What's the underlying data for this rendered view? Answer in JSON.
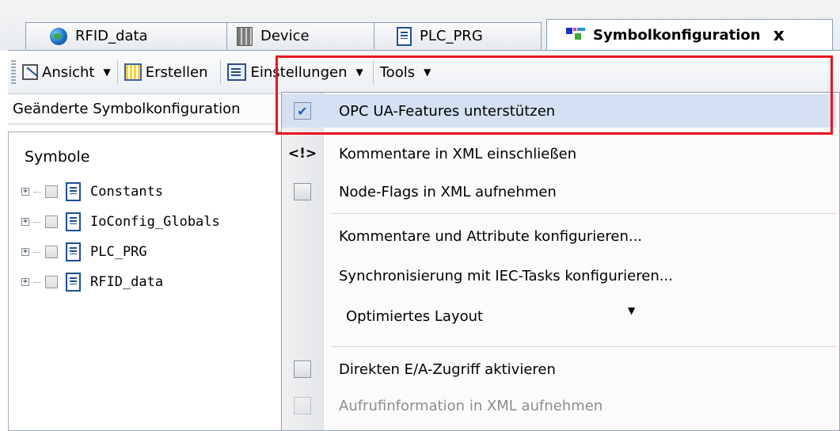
{
  "tabs": [
    {
      "label": "RFID_data",
      "icon": "globe-icon"
    },
    {
      "label": "Device",
      "icon": "device-icon"
    },
    {
      "label": "PLC_PRG",
      "icon": "document-icon"
    },
    {
      "label": "Symbolkonfiguration",
      "icon": "symbol-config-icon",
      "active": true,
      "close": "x"
    }
  ],
  "toolbar": {
    "view_label": "Ansicht",
    "create_label": "Erstellen",
    "settings_label": "Einstellungen",
    "tools_label": "Tools"
  },
  "status_text": "Geänderte Symbolkonfiguration",
  "tree": {
    "title": "Symbole",
    "items": [
      {
        "label": "Constants"
      },
      {
        "label": "IoConfig_Globals"
      },
      {
        "label": "PLC_PRG"
      },
      {
        "label": "RFID_data"
      }
    ]
  },
  "menu": {
    "items": [
      {
        "label": "OPC UA-Features unterstützen",
        "checked": true
      },
      {
        "label": "Kommentare in XML einschließen",
        "icon": "<!>"
      },
      {
        "label": "Node-Flags in XML aufnehmen",
        "checked": false
      },
      {
        "label": "Kommentare und Attribute konfigurieren..."
      },
      {
        "label": "Synchronisierung mit IEC-Tasks konfigurieren..."
      },
      {
        "label": "Optimiertes Layout",
        "type": "select"
      },
      {
        "label": "Direkten E/A-Zugriff aktivieren",
        "checked": false
      },
      {
        "label": "Aufrufinformation in XML aufnehmen",
        "disabled": true
      }
    ]
  },
  "colors": {
    "highlight_border": "#e8151d",
    "menu_highlight": "#d5e1f2"
  }
}
